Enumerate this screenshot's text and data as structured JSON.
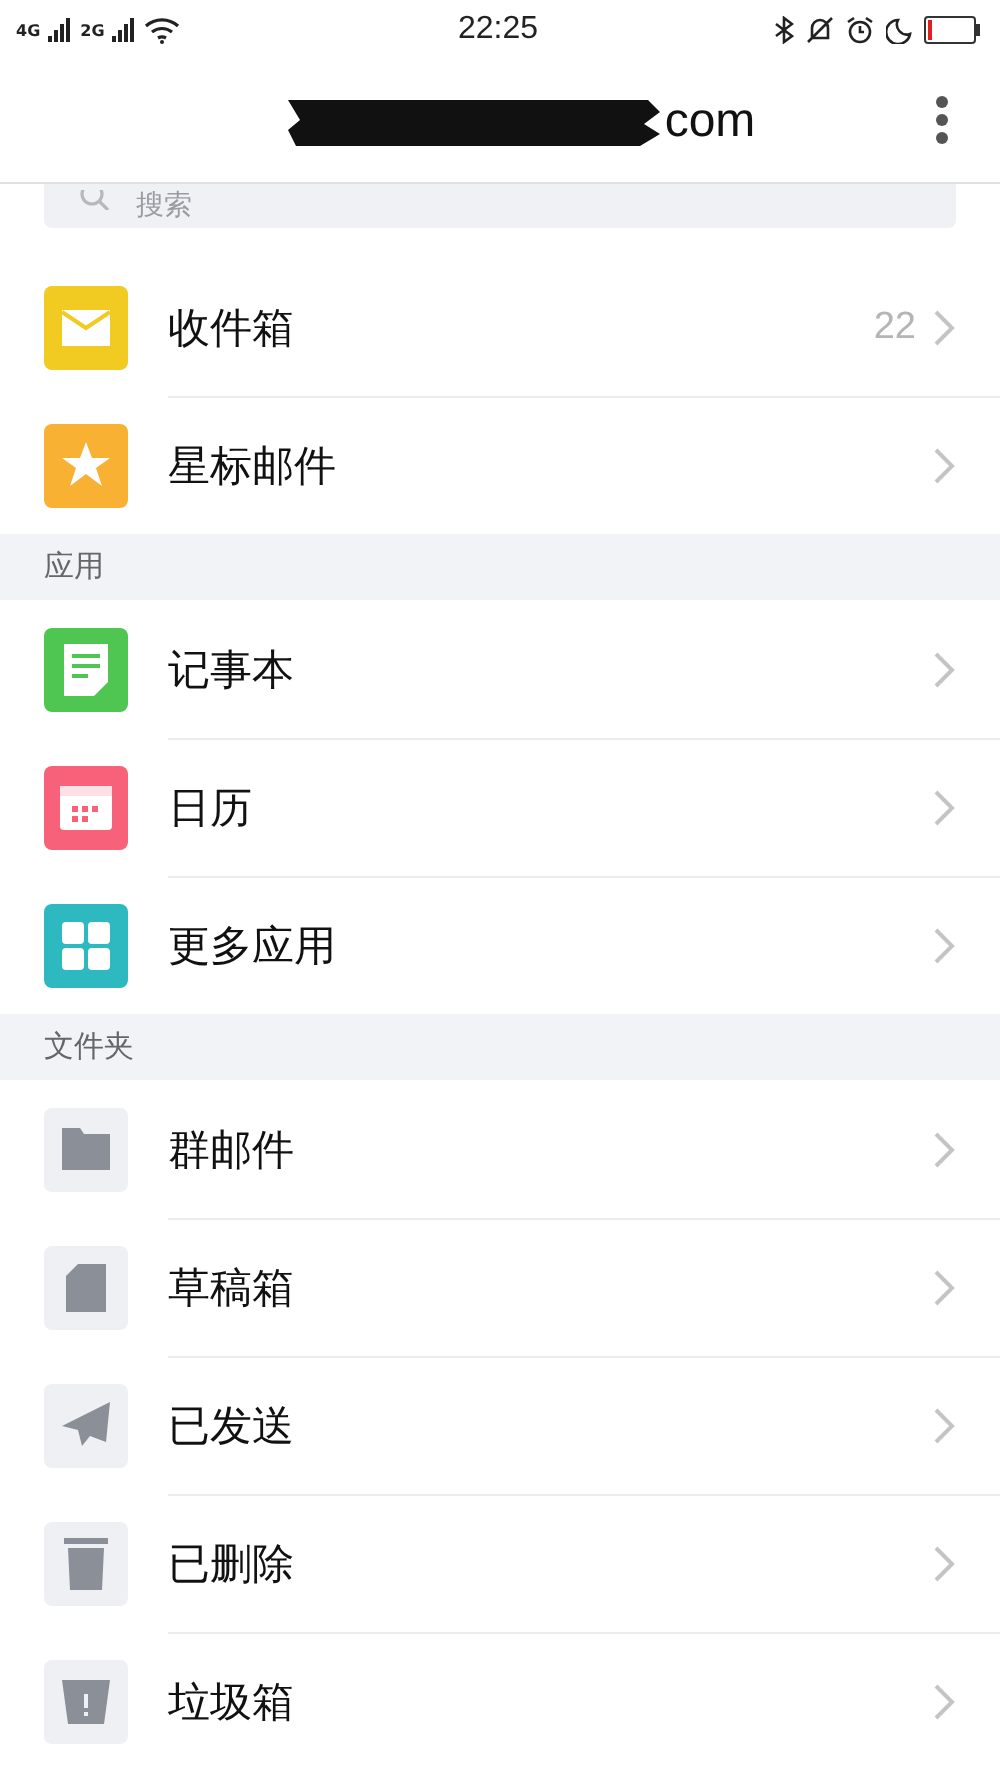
{
  "status_bar": {
    "network_1": "4G",
    "network_2": "2G",
    "time": "22:25"
  },
  "header": {
    "title": "com"
  },
  "search": {
    "placeholder": "搜索"
  },
  "sections": [
    {
      "rows": [
        {
          "kind": "mail",
          "color": "#f2cb22",
          "label": "收件箱",
          "count": "22"
        },
        {
          "kind": "star",
          "color": "#f8b133",
          "label": "星标邮件"
        }
      ]
    },
    {
      "heading": "应用",
      "rows": [
        {
          "kind": "note",
          "color": "#4fc552",
          "label": "记事本"
        },
        {
          "kind": "calendar",
          "color": "#f7627a",
          "label": "日历"
        },
        {
          "kind": "grid",
          "color": "#2eb8bf",
          "label": "更多应用"
        }
      ]
    },
    {
      "heading": "文件夹",
      "rows": [
        {
          "kind": "folder",
          "color": "#eff0f3",
          "label": "群邮件"
        },
        {
          "kind": "doc",
          "color": "#eff0f3",
          "label": "草稿箱"
        },
        {
          "kind": "plane",
          "color": "#eff0f3",
          "label": "已发送"
        },
        {
          "kind": "trash",
          "color": "#eff0f3",
          "label": "已删除"
        },
        {
          "kind": "bin",
          "color": "#eff0f3",
          "label": "垃圾箱"
        }
      ]
    }
  ]
}
